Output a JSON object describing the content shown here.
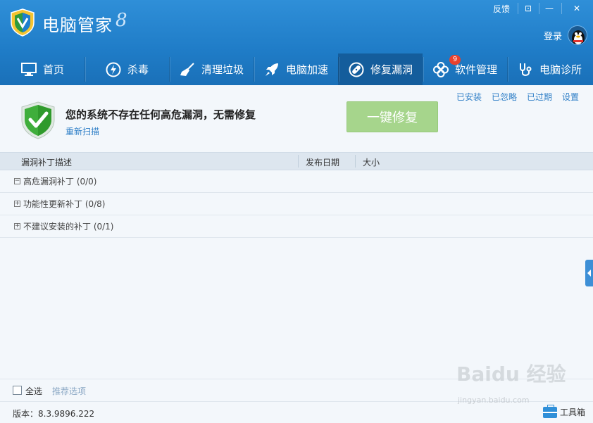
{
  "app": {
    "title": "电脑管家",
    "version_mark": "8"
  },
  "window_controls": {
    "feedback": "反馈",
    "skin": "⊡",
    "minimize": "—",
    "close": "✕"
  },
  "account": {
    "login": "登录"
  },
  "nav": {
    "tabs": [
      {
        "label": "首页",
        "icon": "monitor-icon"
      },
      {
        "label": "杀毒",
        "icon": "lightning-icon"
      },
      {
        "label": "清理垃圾",
        "icon": "broom-icon"
      },
      {
        "label": "电脑加速",
        "icon": "rocket-icon"
      },
      {
        "label": "修复漏洞",
        "icon": "bandage-icon",
        "active": true
      },
      {
        "label": "软件管理",
        "icon": "clover-icon",
        "badge": "9"
      },
      {
        "label": "电脑诊所",
        "icon": "stethoscope-icon"
      }
    ]
  },
  "toplinks": [
    "已安装",
    "已忽略",
    "已过期",
    "设置"
  ],
  "status": {
    "title": "您的系统不存在任何高危漏洞，无需修复",
    "rescan": "重新扫描",
    "fix_button": "一键修复"
  },
  "table": {
    "columns": [
      "漏洞补丁描述",
      "发布日期",
      "大小"
    ],
    "groups": [
      {
        "label": "高危漏洞补丁 (0/0)",
        "expanded": true
      },
      {
        "label": "功能性更新补丁 (0/8)",
        "expanded": false
      },
      {
        "label": "不建议安装的补丁 (0/1)",
        "expanded": false
      }
    ]
  },
  "bottom": {
    "select_all": "全选",
    "recommend": "推荐选项"
  },
  "footer": {
    "version": "版本：8.3.9896.222",
    "toolbox": "工具箱"
  },
  "watermark": {
    "brand": "Baidu 经验",
    "url": "jingyan.baidu.com"
  },
  "colors": {
    "header": "#1f7cc7",
    "active_tab": "#145d9c",
    "fix_button": "#a6d58c",
    "link": "#2f7fc7"
  }
}
